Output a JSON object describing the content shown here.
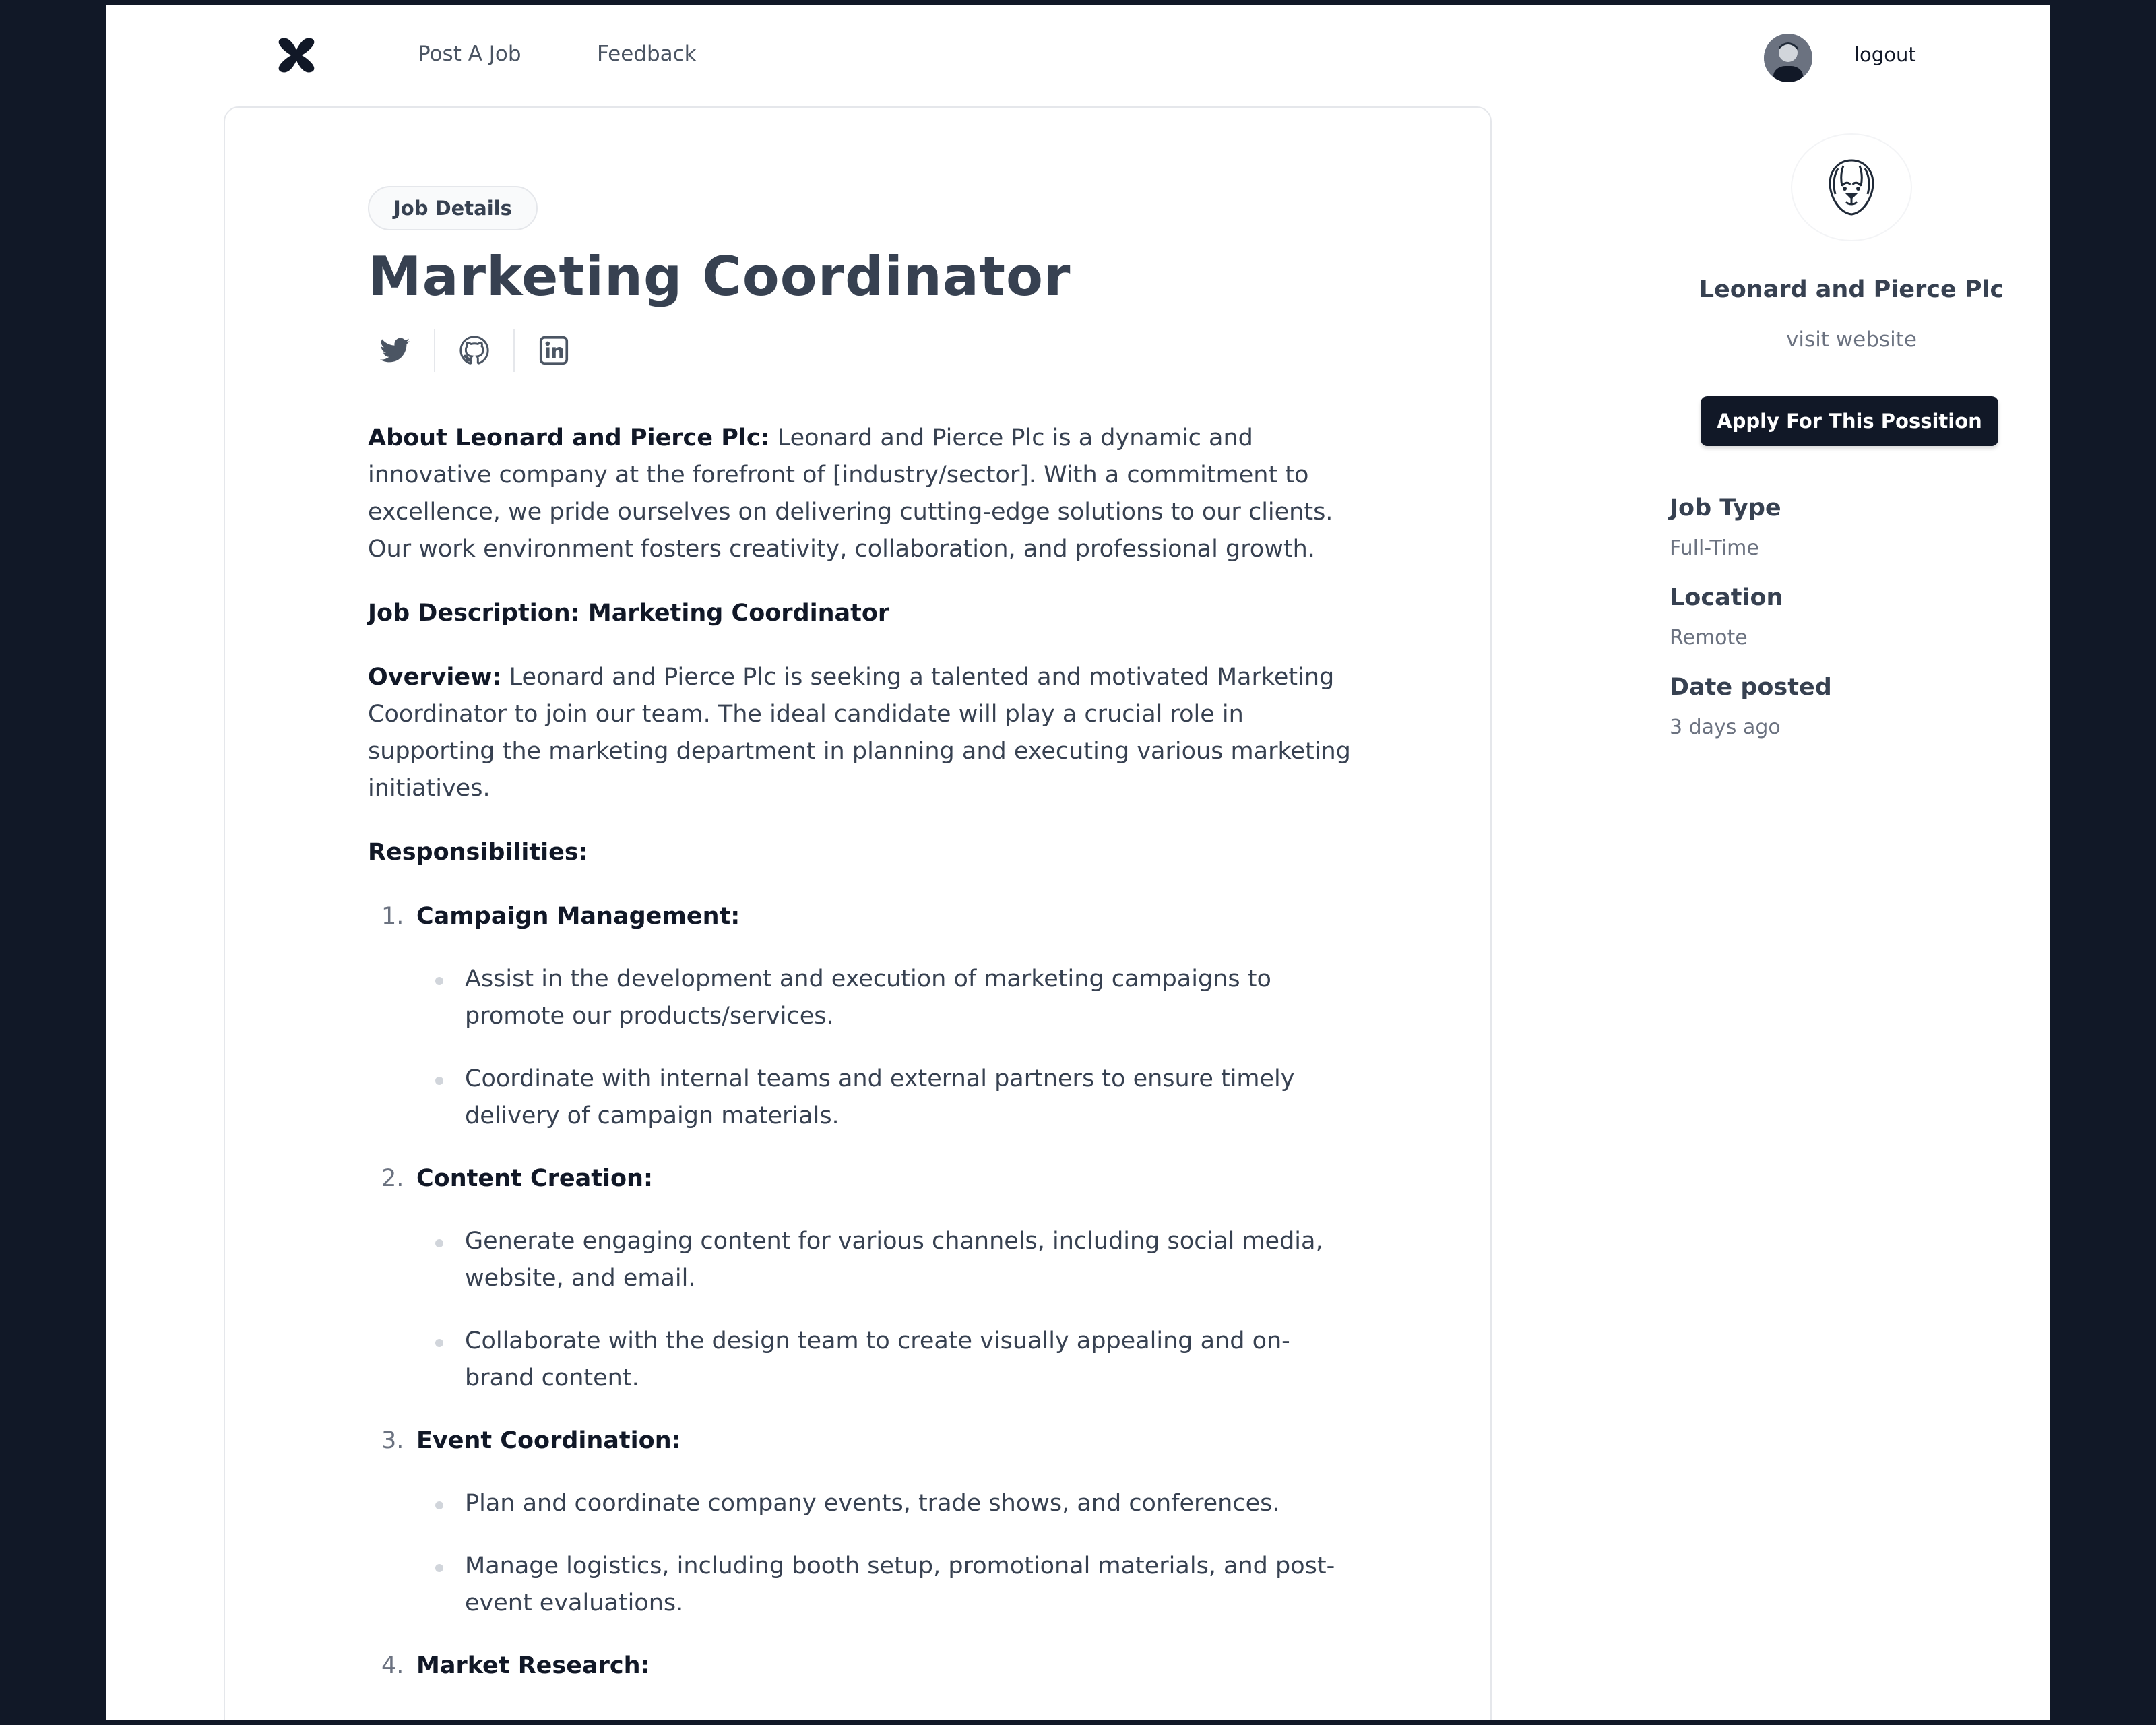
{
  "header": {
    "nav": [
      "Post A Job",
      "Feedback"
    ],
    "logout_label": "logout"
  },
  "job": {
    "badge": "Job Details",
    "title": "Marketing Coordinator",
    "socials": [
      "twitter-icon",
      "github-icon",
      "linkedin-icon"
    ],
    "about_label": "About Leonard and Pierce Plc:",
    "about_text": "Leonard and Pierce Plc is a dynamic and innovative company at the forefront of [industry/sector]. With a commitment to excellence, we pride ourselves on delivering cutting-edge solutions to our clients. Our work environment fosters creativity, collaboration, and professional growth.",
    "description_heading": "Job Description: Marketing Coordinator",
    "overview_label": "Overview:",
    "overview_text": "Leonard and Pierce Plc is seeking a talented and motivated Marketing Coordinator to join our team. The ideal candidate will play a crucial role in supporting the marketing department in planning and executing various marketing initiatives.",
    "responsibilities_heading": "Responsibilities:",
    "responsibilities": [
      {
        "num": "1.",
        "title": "Campaign Management:",
        "items": [
          "Assist in the development and execution of marketing campaigns to promote our products/services.",
          "Coordinate with internal teams and external partners to ensure timely delivery of campaign materials."
        ]
      },
      {
        "num": "2.",
        "title": "Content Creation:",
        "items": [
          "Generate engaging content for various channels, including social media, website, and email.",
          "Collaborate with the design team to create visually appealing and on-brand content."
        ]
      },
      {
        "num": "3.",
        "title": "Event Coordination:",
        "items": [
          "Plan and coordinate company events, trade shows, and conferences.",
          "Manage logistics, including booth setup, promotional materials, and post-event evaluations."
        ]
      },
      {
        "num": "4.",
        "title": "Market Research:",
        "items": []
      }
    ]
  },
  "sidebar": {
    "company_name": "Leonard and Pierce Plc",
    "visit_label": "visit website",
    "apply_label": "Apply For This Possition",
    "meta": [
      {
        "label": "Job Type",
        "value": "Full-Time"
      },
      {
        "label": "Location",
        "value": "Remote"
      },
      {
        "label": "Date posted",
        "value": "3 days ago"
      }
    ]
  }
}
